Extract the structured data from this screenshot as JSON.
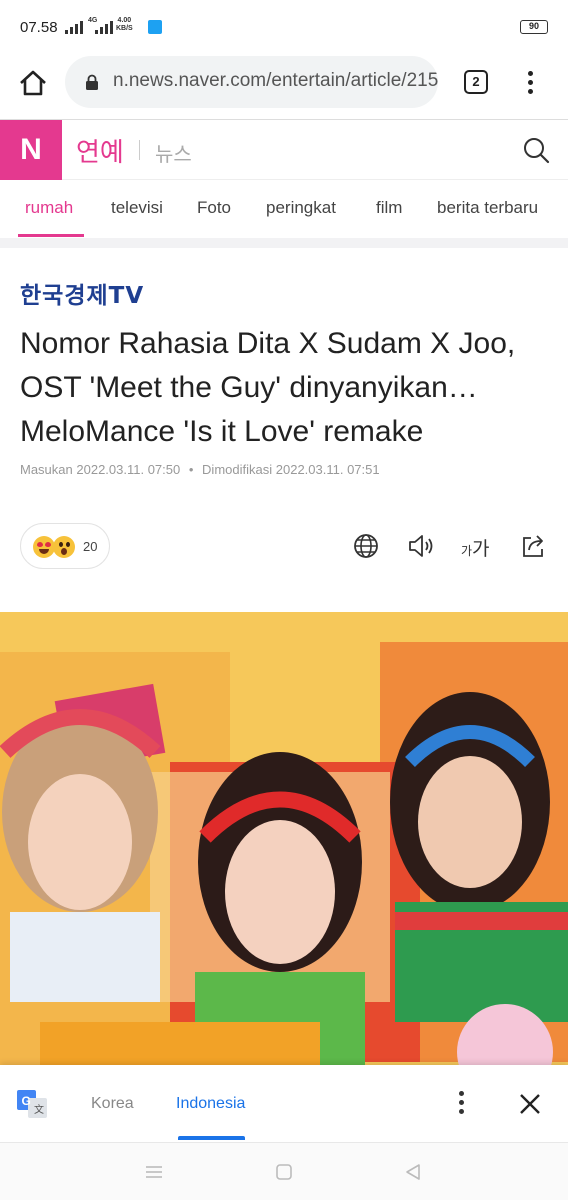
{
  "status_bar": {
    "time": "07.58",
    "net_type": "4G",
    "net_speed": "4.00",
    "net_unit": "KB/S",
    "battery": "90"
  },
  "browser": {
    "url": "n.news.naver.com/entertain/article/215",
    "tab_count": "2"
  },
  "header": {
    "logo": "N",
    "section": "연예",
    "sub": "뉴스"
  },
  "nav_tabs": [
    {
      "label": "rumah",
      "active": true
    },
    {
      "label": "televisi"
    },
    {
      "label": "Foto"
    },
    {
      "label": "peringkat"
    },
    {
      "label": "film"
    },
    {
      "label": "berita terbaru"
    }
  ],
  "article": {
    "publisher": "한국경제TV",
    "headline_lines": [
      "Nomor Rahasia Dita X Sudam X Joo,",
      "OST 'Meet the Guy' dinyanyikan…",
      "MeloMance 'Is it Love' remake"
    ],
    "meta": {
      "input_label": "Masukan",
      "input_time": "2022.03.11. 07:50",
      "modified_label": "Dimodifikasi",
      "modified_time": "2022.03.11. 07:51"
    },
    "reaction_count": "20"
  },
  "translate_bar": {
    "lang_source": "Korea",
    "lang_target": "Indonesia"
  },
  "colors": {
    "naver_pink": "#e4398f",
    "publisher_blue": "#1f3f91",
    "translate_blue": "#1a73e8"
  }
}
